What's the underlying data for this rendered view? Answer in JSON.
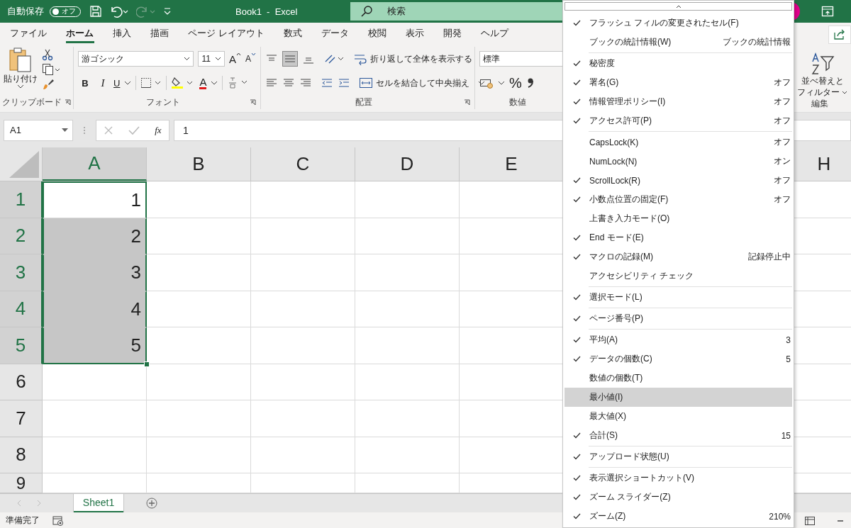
{
  "title_bar": {
    "autosave": "自動保存",
    "autosave_toggle": {
      "label": "オフ",
      "on": false
    },
    "title": "Book1  -  Excel",
    "search": {
      "placeholder": "検索"
    }
  },
  "ribbon_tabs": [
    {
      "label": "ファイル",
      "selected": false
    },
    {
      "label": "ホーム",
      "selected": true
    },
    {
      "label": "挿入",
      "selected": false
    },
    {
      "label": "描画",
      "selected": false
    },
    {
      "label": "ページ レイアウト",
      "selected": false
    },
    {
      "label": "数式",
      "selected": false
    },
    {
      "label": "データ",
      "selected": false
    },
    {
      "label": "校閲",
      "selected": false
    },
    {
      "label": "表示",
      "selected": false
    },
    {
      "label": "開発",
      "selected": false
    },
    {
      "label": "ヘルプ",
      "selected": false
    }
  ],
  "ribbon": {
    "clipboard": {
      "paste": "貼り付け",
      "label": "クリップボード"
    },
    "font": {
      "name": "游ゴシック",
      "size": "11",
      "grow": "A",
      "shrink": "A",
      "bold": "B",
      "italic": "I",
      "underline": "U",
      "font_color": "A",
      "label": "フォント"
    },
    "alignment": {
      "wrap_text": "折り返して全体を表示する",
      "merge": "セルを結合して中央揃え",
      "label": "配置"
    },
    "number": {
      "format": "標準",
      "percent": "%",
      "label": "数値"
    },
    "editing": {
      "sort_filter_line_1": "並べ替えと",
      "sort_filter_line_2": "フィルター",
      "label": "編集"
    }
  },
  "formula_bar": {
    "name_box": "A1",
    "function_label": "fx",
    "value": "1"
  },
  "columns": [
    {
      "label": "A",
      "selected": true
    },
    {
      "label": "B",
      "selected": false
    },
    {
      "label": "C",
      "selected": false
    },
    {
      "label": "D",
      "selected": false
    },
    {
      "label": "E",
      "selected": false
    },
    {
      "label": "H",
      "selected": false
    }
  ],
  "rows": [
    {
      "label": "1",
      "selected": true,
      "cell": {
        "value": "1",
        "highlighted": false
      }
    },
    {
      "label": "2",
      "selected": true,
      "cell": {
        "value": "2",
        "highlighted": true
      }
    },
    {
      "label": "3",
      "selected": true,
      "cell": {
        "value": "3",
        "highlighted": true
      }
    },
    {
      "label": "4",
      "selected": true,
      "cell": {
        "value": "4",
        "highlighted": true
      }
    },
    {
      "label": "5",
      "selected": true,
      "cell": {
        "value": "5",
        "highlighted": true
      }
    },
    {
      "label": "6",
      "selected": false
    },
    {
      "label": "7",
      "selected": false
    },
    {
      "label": "8",
      "selected": false
    },
    {
      "label": "9",
      "selected": false
    }
  ],
  "sheet_tabs": [
    {
      "label": "Sheet1",
      "selected": true
    }
  ],
  "status_bar": {
    "status": "準備完了"
  },
  "context_menu": {
    "items": [
      {
        "kind": "item",
        "label": "フラッシュ フィルの変更されたセル(F)",
        "checked": true,
        "highlighted": false
      },
      {
        "kind": "item",
        "label": "ブックの統計情報(W)",
        "checked": false,
        "highlighted": false,
        "value": "ブックの統計情報"
      },
      {
        "kind": "separator"
      },
      {
        "kind": "item",
        "label": "秘密度",
        "checked": true,
        "highlighted": false
      },
      {
        "kind": "item",
        "label": "署名(G)",
        "checked": true,
        "highlighted": false,
        "value": "オフ"
      },
      {
        "kind": "item",
        "label": "情報管理ポリシー(I)",
        "checked": true,
        "highlighted": false,
        "value": "オフ"
      },
      {
        "kind": "item",
        "label": "アクセス許可(P)",
        "checked": true,
        "highlighted": false,
        "value": "オフ"
      },
      {
        "kind": "separator"
      },
      {
        "kind": "item",
        "label": "CapsLock(K)",
        "checked": false,
        "highlighted": false,
        "value": "オフ"
      },
      {
        "kind": "item",
        "label": "NumLock(N)",
        "checked": false,
        "highlighted": false,
        "value": "オン"
      },
      {
        "kind": "item",
        "label": "ScrollLock(R)",
        "checked": true,
        "highlighted": false,
        "value": "オフ"
      },
      {
        "kind": "item",
        "label": "小数点位置の固定(F)",
        "checked": true,
        "highlighted": false,
        "value": "オフ"
      },
      {
        "kind": "item",
        "label": "上書き入力モード(O)",
        "checked": false,
        "highlighted": false
      },
      {
        "kind": "item",
        "label": "End モード(E)",
        "checked": true,
        "highlighted": false
      },
      {
        "kind": "item",
        "label": "マクロの記録(M)",
        "checked": true,
        "highlighted": false,
        "value": "記録停止中"
      },
      {
        "kind": "item",
        "label": "アクセシビリティ チェック",
        "checked": false,
        "highlighted": false
      },
      {
        "kind": "separator"
      },
      {
        "kind": "item",
        "label": "選択モード(L)",
        "checked": true,
        "highlighted": false
      },
      {
        "kind": "separator"
      },
      {
        "kind": "item",
        "label": "ページ番号(P)",
        "checked": true,
        "highlighted": false
      },
      {
        "kind": "separator"
      },
      {
        "kind": "item",
        "label": "平均(A)",
        "checked": true,
        "highlighted": false,
        "value": "3"
      },
      {
        "kind": "item",
        "label": "データの個数(C)",
        "checked": true,
        "highlighted": false,
        "value": "5"
      },
      {
        "kind": "item",
        "label": "数値の個数(T)",
        "checked": false,
        "highlighted": false
      },
      {
        "kind": "item",
        "label": "最小値(I)",
        "checked": false,
        "highlighted": true
      },
      {
        "kind": "item",
        "label": "最大値(X)",
        "checked": false,
        "highlighted": false
      },
      {
        "kind": "item",
        "label": "合計(S)",
        "checked": true,
        "highlighted": false,
        "value": "15"
      },
      {
        "kind": "separator"
      },
      {
        "kind": "item",
        "label": "アップロード状態(U)",
        "checked": true,
        "highlighted": false
      },
      {
        "kind": "separator"
      },
      {
        "kind": "item",
        "label": "表示選択ショートカット(V)",
        "checked": true,
        "highlighted": false
      },
      {
        "kind": "item",
        "label": "ズーム スライダー(Z)",
        "checked": true,
        "highlighted": false
      },
      {
        "kind": "item",
        "label": "ズーム(Z)",
        "checked": true,
        "highlighted": false,
        "value": "210%"
      }
    ]
  }
}
